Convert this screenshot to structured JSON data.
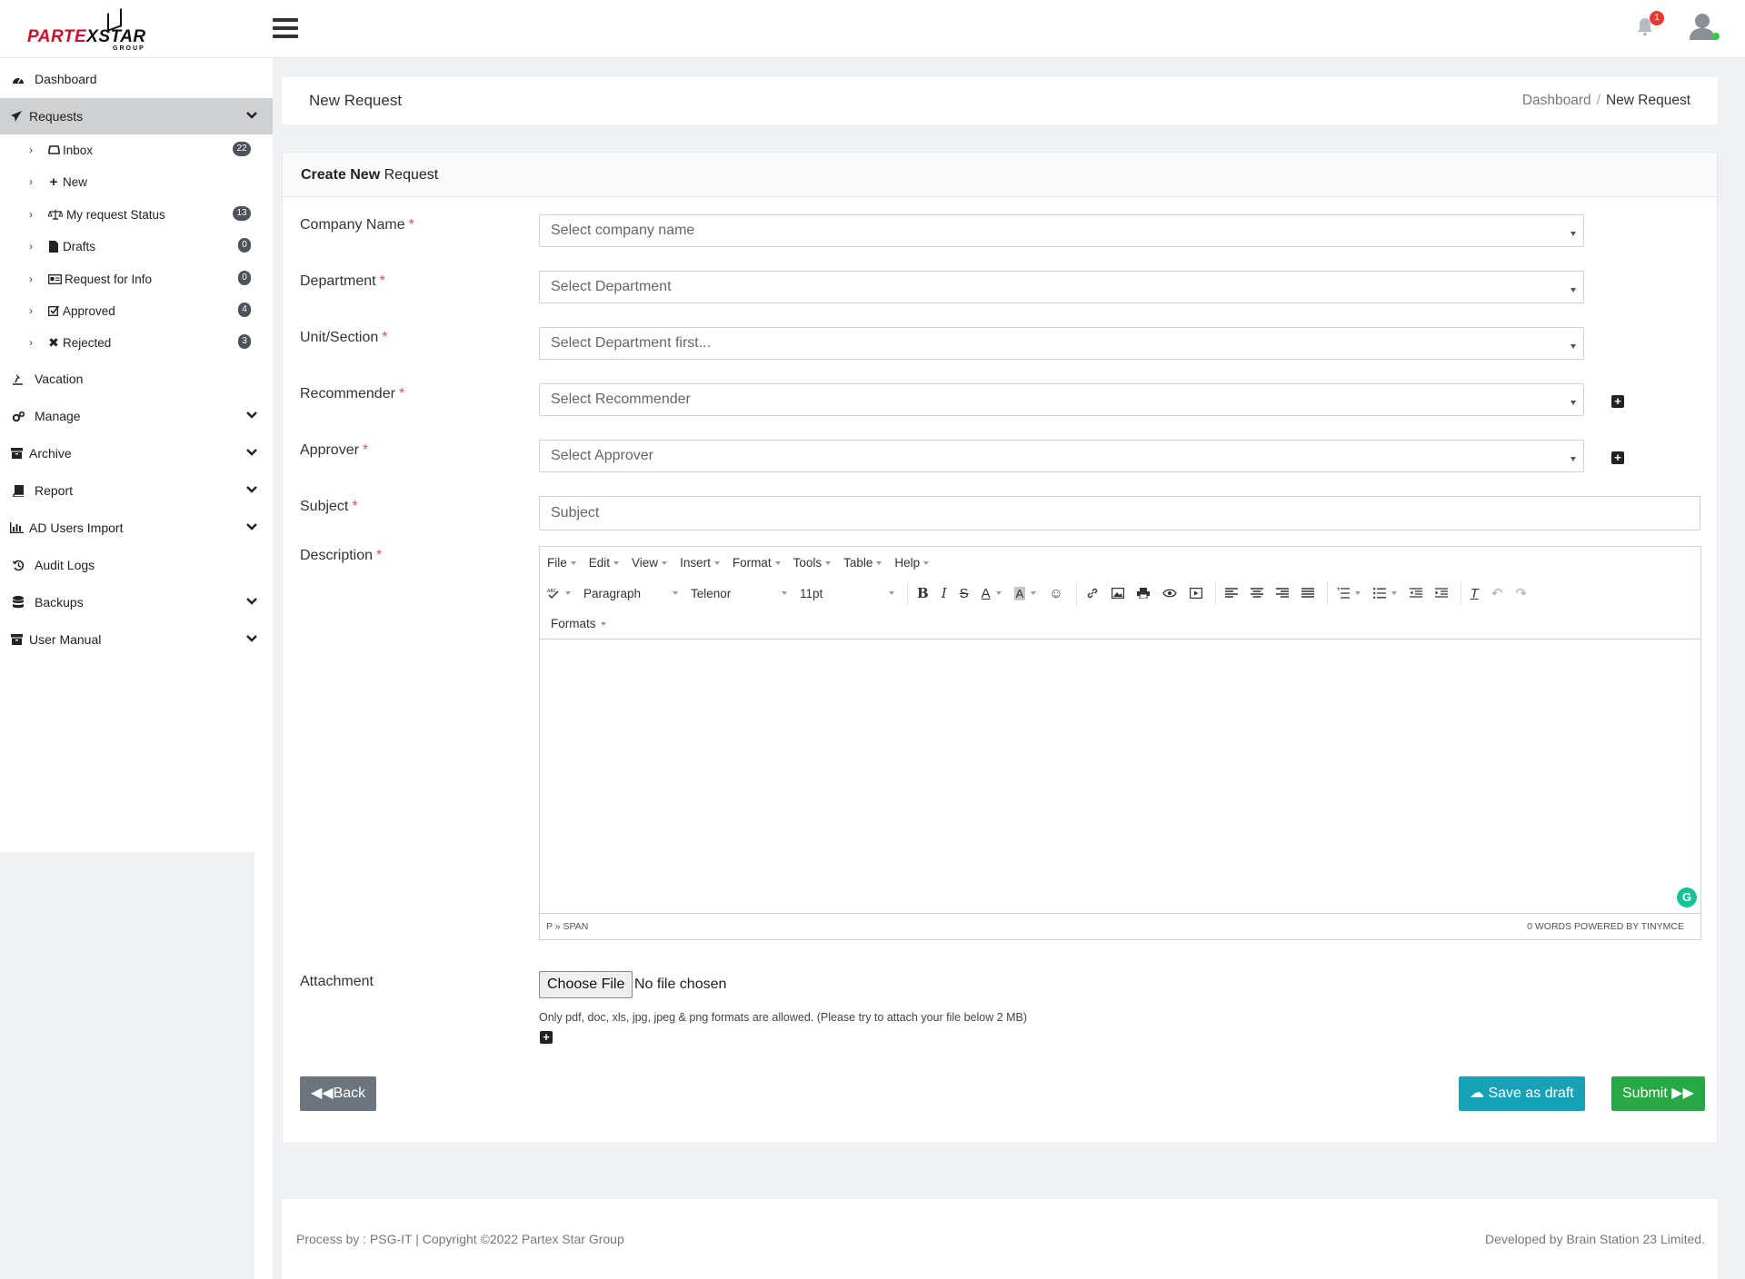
{
  "brand": {
    "logo_text_a": "PARTE",
    "logo_text_x": "X",
    "logo_text_b": "STAR",
    "logo_sub": "GROUP",
    "notification_count": "1"
  },
  "sidebar": {
    "items": [
      {
        "label": "Dashboard"
      },
      {
        "label": "Requests"
      },
      {
        "label": "Vacation"
      },
      {
        "label": "Manage"
      },
      {
        "label": "Archive"
      },
      {
        "label": "Report"
      },
      {
        "label": "AD Users Import"
      },
      {
        "label": "Audit Logs"
      },
      {
        "label": "Backups"
      },
      {
        "label": "User Manual"
      }
    ],
    "requests_sub": [
      {
        "label": "Inbox",
        "badge": "22"
      },
      {
        "label": "New",
        "badge": ""
      },
      {
        "label": "My request Status",
        "badge": "13"
      },
      {
        "label": "Drafts",
        "badge": "0"
      },
      {
        "label": "Request for Info",
        "badge": "0"
      },
      {
        "label": "Approved",
        "badge": "4"
      },
      {
        "label": "Rejected",
        "badge": "3"
      }
    ]
  },
  "header": {
    "title": "New Request",
    "breadcrumb_root": "Dashboard",
    "breadcrumb_sep": "/",
    "breadcrumb_current": "New Request"
  },
  "form": {
    "card_title_bold": "Create New",
    "card_title_rest": "Request",
    "required_mark": "*",
    "company": {
      "label": "Company Name",
      "placeholder": "Select company name"
    },
    "department": {
      "label": "Department",
      "placeholder": "Select Department"
    },
    "unit": {
      "label": "Unit/Section",
      "placeholder": "Select Department first..."
    },
    "recommender": {
      "label": "Recommender",
      "placeholder": "Select Recommender"
    },
    "approver": {
      "label": "Approver",
      "placeholder": "Select Approver"
    },
    "subject": {
      "label": "Subject",
      "placeholder": "Subject"
    },
    "description": {
      "label": "Description"
    },
    "attachment": {
      "label": "Attachment",
      "button": "Choose File",
      "status": "No file chosen",
      "hint": "Only pdf, doc, xls, jpg, jpeg & png formats are allowed. (Please try to attach your file below 2 MB)"
    },
    "back_label": "Back",
    "draft_label": "Save as draft",
    "submit_label": "Submit"
  },
  "editor": {
    "menus": [
      "File",
      "Edit",
      "View",
      "Insert",
      "Format",
      "Tools",
      "Table",
      "Help"
    ],
    "block_format": "Paragraph",
    "font_family": "Telenor",
    "font_size": "11pt",
    "formats_label": "Formats",
    "path": "P » SPAN",
    "status_right": "0 WORDS POWERED BY TINYMCE"
  },
  "footer": {
    "left": "Process by : PSG-IT | Copyright ©2022 Partex Star Group",
    "right": "Developed by Brain Station 23 Limited."
  },
  "colors": {
    "brand_red": "#c8102e",
    "draft": "#17a2b8",
    "submit": "#28a745",
    "back": "#6c757d",
    "required": "#d9534f"
  }
}
